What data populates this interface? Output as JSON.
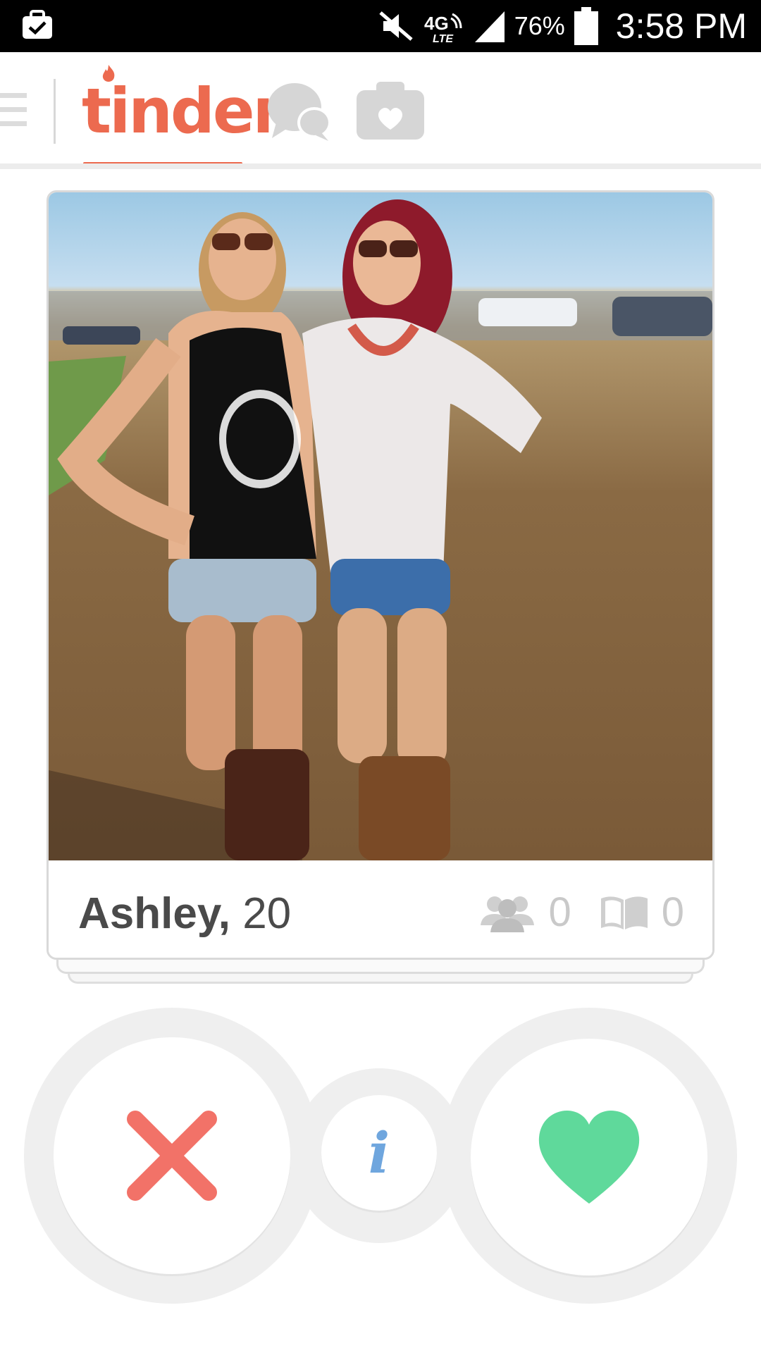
{
  "status_bar": {
    "battery_pct": "76%",
    "time": "3:58 PM",
    "network": "4G LTE",
    "left_icon": "briefcase-check-icon"
  },
  "header": {
    "logo": "tinder",
    "active_tab": "tinder",
    "icons": [
      "menu-icon",
      "chat-bubbles-icon",
      "camera-heart-icon"
    ],
    "accent_color": "#ec6a4f"
  },
  "card": {
    "name": "Ashley,",
    "age": "20",
    "mutual_friends_count": "0",
    "shared_interests_count": "0"
  },
  "actions": {
    "nope_icon": "close-x-icon",
    "info_icon": "info-icon",
    "info_glyph": "i",
    "like_icon": "heart-icon",
    "nope_color": "#f27268",
    "info_color": "#6fa6de",
    "like_color": "#5fd99b"
  }
}
